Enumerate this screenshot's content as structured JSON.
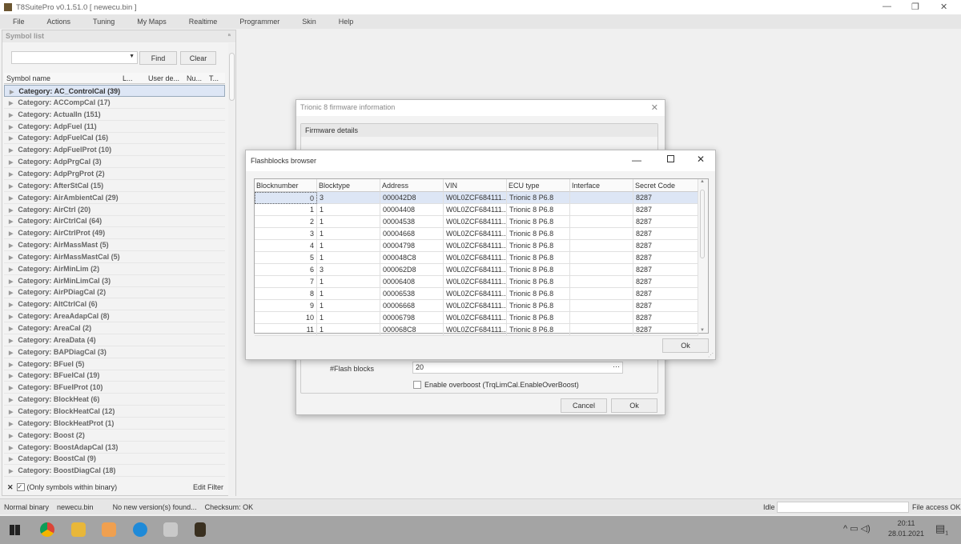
{
  "app": {
    "title": "T8SuitePro v0.1.51.0 [ newecu.bin ]"
  },
  "menu": [
    "File",
    "Actions",
    "Tuning",
    "My Maps",
    "Realtime",
    "Programmer",
    "Skin",
    "Help"
  ],
  "symbol_list": {
    "title": "Symbol list",
    "pin": "ª",
    "find": "Find",
    "clear": "Clear",
    "search_value": "",
    "columns": [
      "Symbol name",
      "L...",
      "User de...",
      "Nu...",
      "T..."
    ],
    "rows": [
      "Category: AC_ControlCal (39)",
      "Category: ACCompCal (17)",
      "Category: ActualIn (151)",
      "Category: AdpFuel (11)",
      "Category: AdpFuelCal (16)",
      "Category: AdpFuelProt (10)",
      "Category: AdpPrgCal (3)",
      "Category: AdpPrgProt (2)",
      "Category: AfterStCal (15)",
      "Category: AirAmbientCal (29)",
      "Category: AirCtrl (20)",
      "Category: AirCtrlCal (64)",
      "Category: AirCtrlProt (49)",
      "Category: AirMassMast (5)",
      "Category: AirMassMastCal (5)",
      "Category: AirMinLim (2)",
      "Category: AirMinLimCal (3)",
      "Category: AirPDiagCal (2)",
      "Category: AltCtrlCal (6)",
      "Category: AreaAdapCal (8)",
      "Category: AreaCal (2)",
      "Category: AreaData (4)",
      "Category: BAPDiagCal (3)",
      "Category: BFuel (5)",
      "Category: BFuelCal (19)",
      "Category: BFuelProt (10)",
      "Category: BlockHeat (6)",
      "Category: BlockHeatCal (12)",
      "Category: BlockHeatProt (1)",
      "Category: Boost (2)",
      "Category: BoostAdapCal (13)",
      "Category: BoostCal (9)",
      "Category: BoostDiagCal (18)"
    ],
    "filter_label": "(Only symbols within binary)",
    "edit_filter": "Edit Filter"
  },
  "firmware_dialog": {
    "title": "Trionic 8 firmware information",
    "group": "Firmware details",
    "flash_blocks_label": "#Flash blocks",
    "flash_blocks_value": "20",
    "ellipsis": "···",
    "overboost_label": "Enable overboost (TrqLimCal.EnableOverBoost)",
    "cancel": "Cancel",
    "ok": "Ok"
  },
  "flash_dialog": {
    "title": "Flashblocks browser",
    "ok": "Ok",
    "columns": [
      "Blocknumber",
      "Blocktype",
      "Address",
      "VIN",
      "ECU type",
      "Interface",
      "Secret Code"
    ],
    "rows": [
      [
        "0",
        "3",
        "000042D8",
        "W0L0ZCF684111...",
        "Trionic 8 P6.8",
        "",
        "8287"
      ],
      [
        "1",
        "1",
        "00004408",
        "W0L0ZCF684111...",
        "Trionic 8 P6.8",
        "",
        "8287"
      ],
      [
        "2",
        "1",
        "00004538",
        "W0L0ZCF684111...",
        "Trionic 8 P6.8",
        "",
        "8287"
      ],
      [
        "3",
        "1",
        "00004668",
        "W0L0ZCF684111...",
        "Trionic 8 P6.8",
        "",
        "8287"
      ],
      [
        "4",
        "1",
        "00004798",
        "W0L0ZCF684111...",
        "Trionic 8 P6.8",
        "",
        "8287"
      ],
      [
        "5",
        "1",
        "000048C8",
        "W0L0ZCF684111...",
        "Trionic 8 P6.8",
        "",
        "8287"
      ],
      [
        "6",
        "3",
        "000062D8",
        "W0L0ZCF684111...",
        "Trionic 8 P6.8",
        "",
        "8287"
      ],
      [
        "7",
        "1",
        "00006408",
        "W0L0ZCF684111...",
        "Trionic 8 P6.8",
        "",
        "8287"
      ],
      [
        "8",
        "1",
        "00006538",
        "W0L0ZCF684111...",
        "Trionic 8 P6.8",
        "",
        "8287"
      ],
      [
        "9",
        "1",
        "00006668",
        "W0L0ZCF684111...",
        "Trionic 8 P6.8",
        "",
        "8287"
      ],
      [
        "10",
        "1",
        "00006798",
        "W0L0ZCF684111...",
        "Trionic 8 P6.8",
        "",
        "8287"
      ],
      [
        "11",
        "1",
        "000068C8",
        "W0L0ZCF684111...",
        "Trionic 8 P6.8",
        "",
        "8287"
      ]
    ]
  },
  "status": {
    "binary_type": "Normal binary",
    "file": "newecu.bin",
    "version": "No new version(s) found...",
    "checksum": "Checksum: OK",
    "state": "Idle",
    "file_access": "File access OK"
  },
  "taskbar": {
    "time": "20:11",
    "date": "28.01.2021",
    "notifications": "1"
  }
}
